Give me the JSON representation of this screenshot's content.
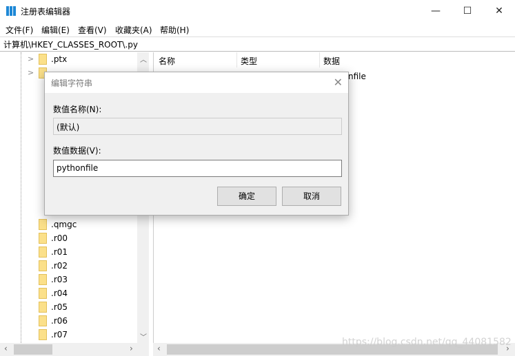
{
  "window": {
    "title": "注册表编辑器",
    "minimize": "—",
    "maximize": "☐",
    "close": "✕"
  },
  "menu": [
    "文件(F)",
    "编辑(E)",
    "查看(V)",
    "收藏夹(A)",
    "帮助(H)"
  ],
  "address": "计算机\\HKEY_CLASSES_ROOT\\.py",
  "tree": {
    "items": [
      ".ptx",
      ".qmgc",
      ".r00",
      ".r01",
      ".r02",
      ".r03",
      ".r04",
      ".r05",
      ".r06",
      ".r07"
    ]
  },
  "list": {
    "columns": [
      "名称",
      "类型",
      "数据"
    ],
    "partial_data": "nfile"
  },
  "dialog": {
    "title": "编辑字符串",
    "name_label": "数值名称(N):",
    "name_value": "(默认)",
    "data_label": "数值数据(V):",
    "data_value": "pythonfile",
    "ok": "确定",
    "cancel": "取消"
  },
  "watermark": "https://blog.csdn.net/qq_44081582"
}
